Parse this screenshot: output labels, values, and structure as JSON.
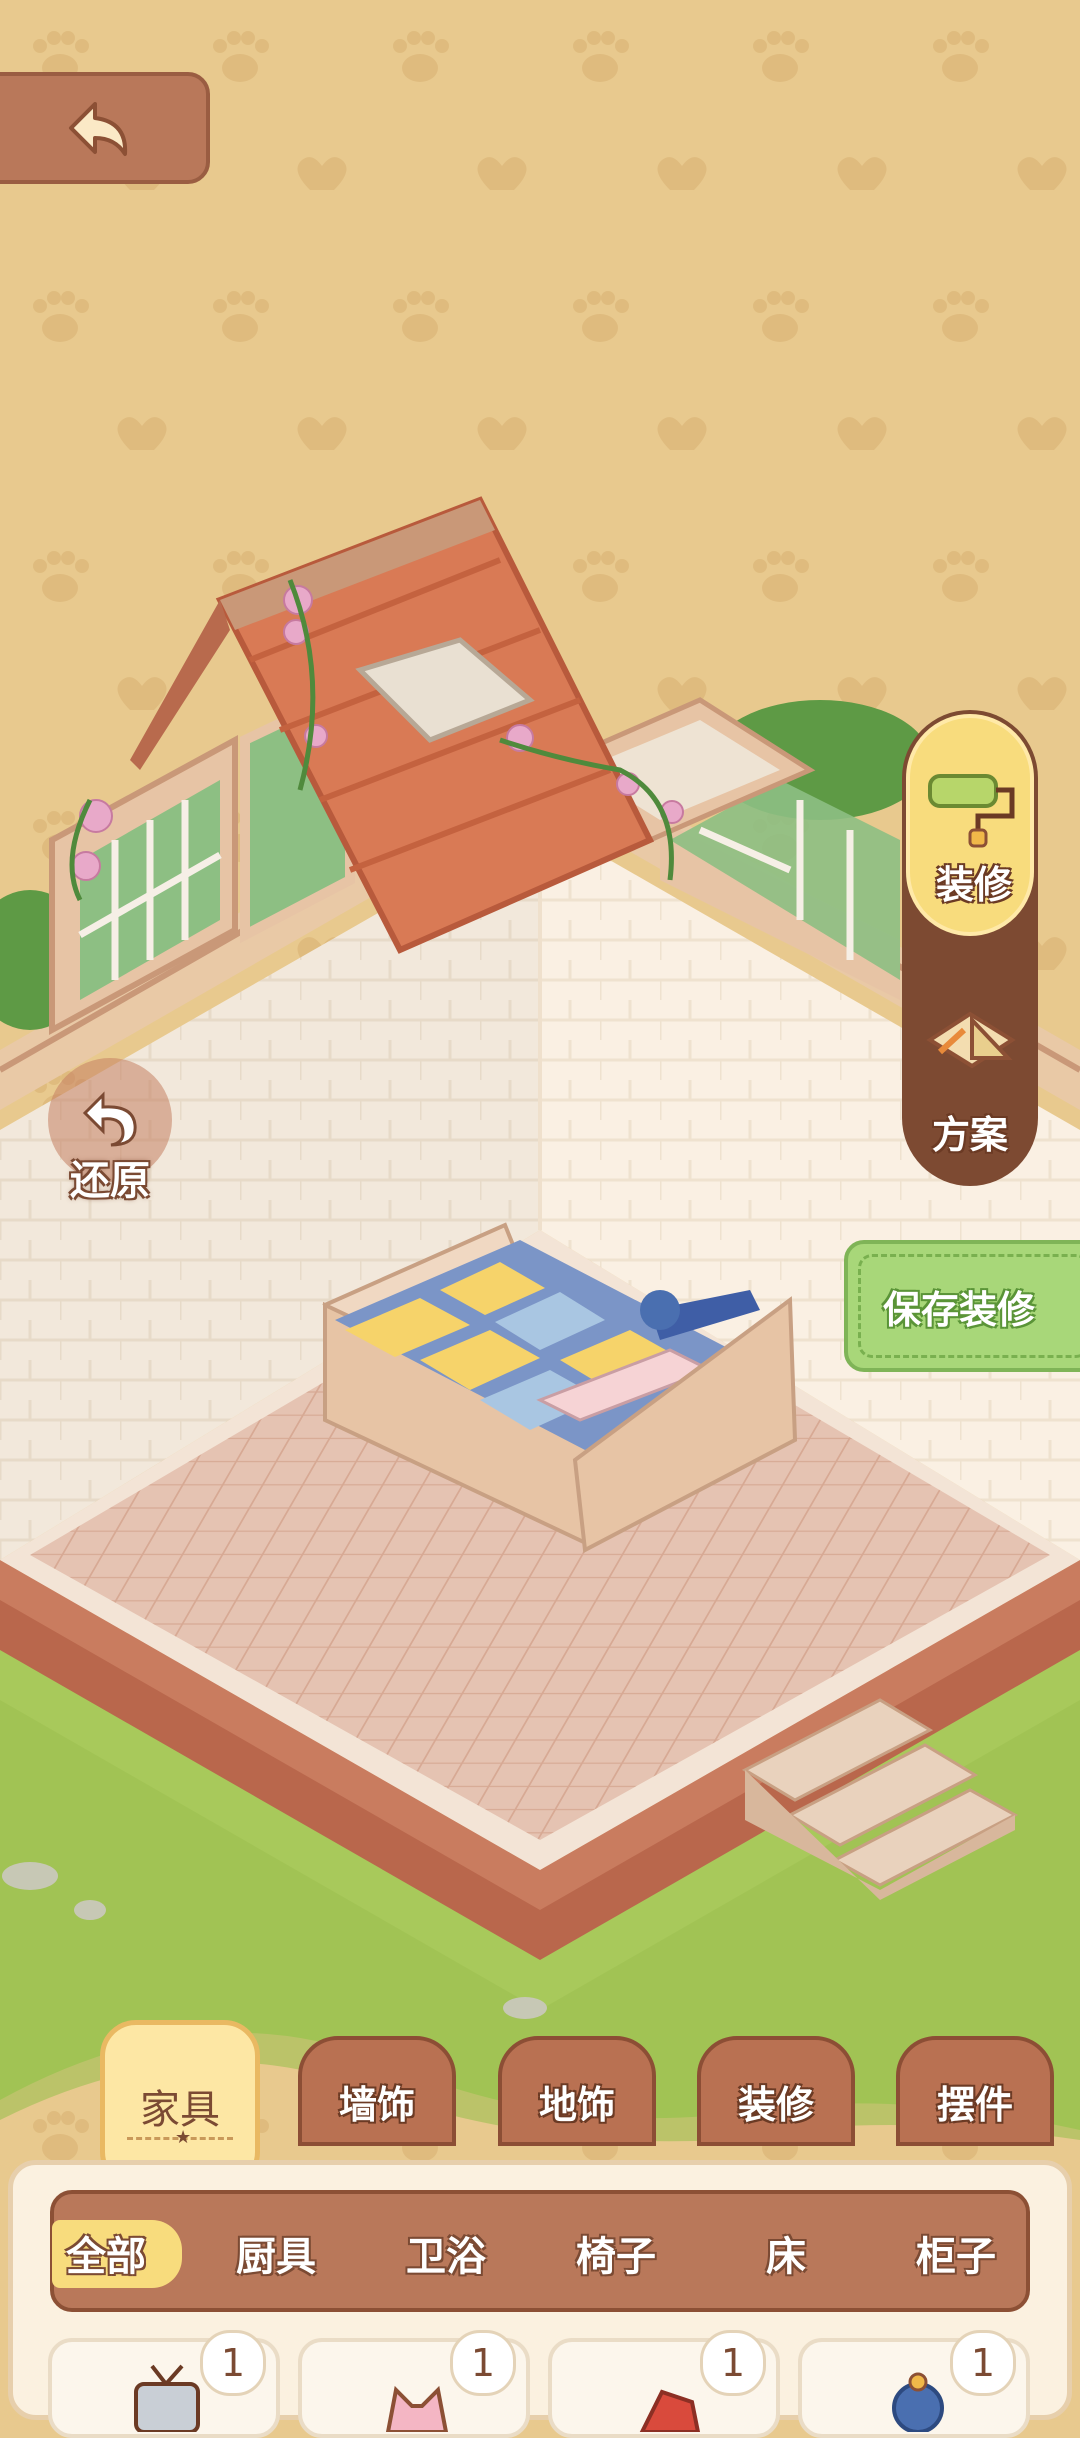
{
  "top": {
    "back_icon": "back-arrow-icon"
  },
  "restore": {
    "label": "还原",
    "icon": "undo-arrow-icon"
  },
  "side_menu": [
    {
      "label": "装修",
      "icon": "paint-roller-icon"
    },
    {
      "label": "方案",
      "icon": "blueprint-icon"
    }
  ],
  "save_button": {
    "label": "保存装修"
  },
  "tabs": [
    {
      "label": "家具",
      "active": true
    },
    {
      "label": "墙饰",
      "active": false
    },
    {
      "label": "地饰",
      "active": false
    },
    {
      "label": "装修",
      "active": false
    },
    {
      "label": "摆件",
      "active": false
    }
  ],
  "subcategories": [
    {
      "label": "全部",
      "active": true
    },
    {
      "label": "厨具",
      "active": false
    },
    {
      "label": "卫浴",
      "active": false
    },
    {
      "label": "椅子",
      "active": false
    },
    {
      "label": "床",
      "active": false
    },
    {
      "label": "柜子",
      "active": false
    }
  ],
  "items": [
    {
      "count": "1",
      "icon": "tv-icon"
    },
    {
      "count": "1",
      "icon": "cat-ear-icon"
    },
    {
      "count": "1",
      "icon": "red-item-icon"
    },
    {
      "count": "1",
      "icon": "blue-item-icon"
    }
  ],
  "colors": {
    "background": "#e8c98e",
    "panel": "#fbf1e0",
    "tab": "#b97152",
    "accent_yellow": "#f8dc7d",
    "save_green": "#a8d779"
  }
}
